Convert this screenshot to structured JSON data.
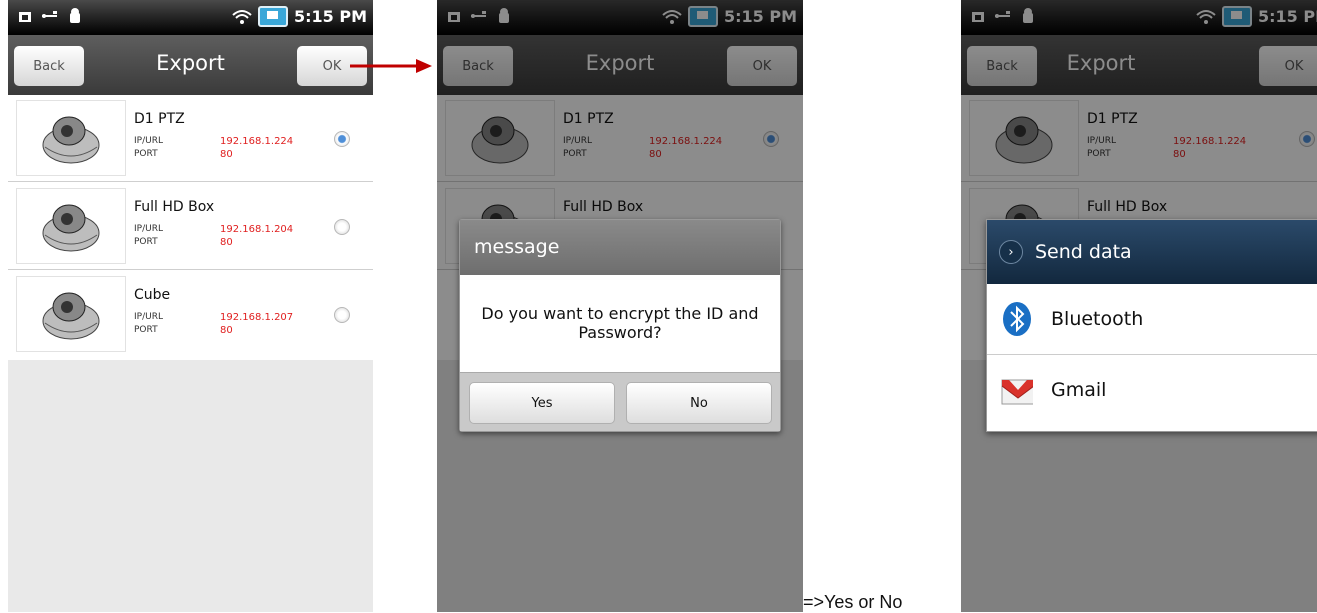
{
  "status_bar": {
    "time": "5:15 PM"
  },
  "screen1": {
    "back_label": "Back",
    "title": "Export",
    "ok_label": "OK",
    "cameras": [
      {
        "name": "D1 PTZ",
        "ip_label": "IP/URL",
        "ip": "192.168.1.224",
        "port_label": "PORT",
        "port": "80",
        "selected": true
      },
      {
        "name": "Full HD Box",
        "ip_label": "IP/URL",
        "ip": "192.168.1.204",
        "port_label": "PORT",
        "port": "80",
        "selected": false
      },
      {
        "name": "Cube",
        "ip_label": "IP/URL",
        "ip": "192.168.1.207",
        "port_label": "PORT",
        "port": "80",
        "selected": false
      }
    ]
  },
  "screen2": {
    "dialog_title": "message",
    "dialog_message": "Do you want to encrypt the ID and Password?",
    "yes_label": "Yes",
    "no_label": "No"
  },
  "screen3": {
    "sheet_title": "Send data",
    "options": [
      {
        "label": "Bluetooth",
        "icon": "bluetooth-icon"
      },
      {
        "label": "Gmail",
        "icon": "gmail-icon"
      }
    ]
  },
  "caption": "=>Yes or No",
  "colors": {
    "ip_text": "#e02020",
    "selected_radio": "#4f8fd8",
    "arrow": "#c00000",
    "sheet_header": "#1b3550"
  }
}
